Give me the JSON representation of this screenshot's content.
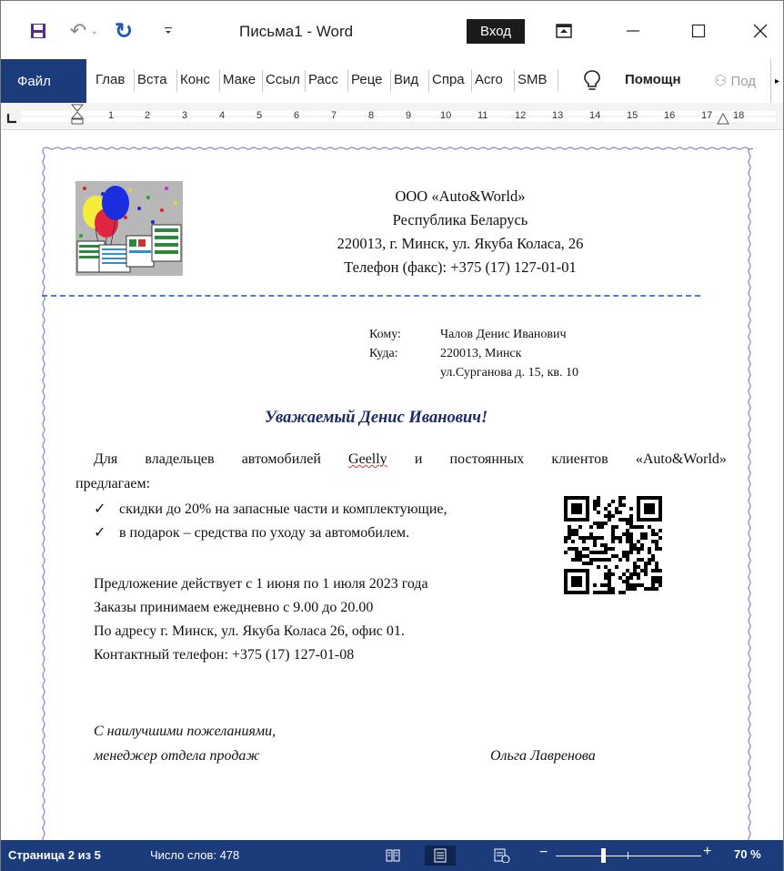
{
  "titlebar": {
    "doc_title": "Письма1  -  Word",
    "signin_label": "Вход"
  },
  "ribbon": {
    "file_tab": "Файл",
    "tabs": [
      "Глав",
      "Вста",
      "Конс",
      "Маке",
      "Ссыл",
      "Расс",
      "Реце",
      "Вид",
      "Спра",
      "Acro",
      "SMB"
    ],
    "help_label": "Помощн",
    "share_label": "Под"
  },
  "ruler": {
    "numbers": [
      "1",
      "2",
      "3",
      "4",
      "5",
      "6",
      "7",
      "8",
      "9",
      "10",
      "11",
      "12",
      "13",
      "14",
      "15",
      "16",
      "17",
      "18"
    ]
  },
  "letter": {
    "company_lines": [
      "ООО «Auto&World»",
      "Республика Беларусь",
      "220013, г. Минск, ул. Якуба Коласа, 26",
      "Телефон (факс): +375 (17) 127-01-01"
    ],
    "to_label": "Кому:",
    "to_value": "Чалов Денис Иванович",
    "where_label": "Куда:",
    "where_line1": "220013, Минск",
    "where_line2": "ул.Сурганова д. 15, кв. 10",
    "greeting": "Уважаемый Денис Иванович!",
    "intro_part1": "Для владельцев автомобилей ",
    "intro_brand": "Geelly",
    "intro_part2": " и постоянных клиентов «Auto&World»",
    "intro_line2": "предлагаем:",
    "check_mark": "✓",
    "bullet1": "скидки до 20% на запасные части и комплектующие,",
    "bullet2": "в подарок – средства по уходу за автомобилем.",
    "info1": "Предложение действует с 1 июня по 1 июля 2023 года",
    "info2": "Заказы принимаем ежедневно с 9.00 до 20.00",
    "info3": "По адресу г. Минск, ул. Якуба Коласа 26, офис 01.",
    "info4": "Контактный телефон: +375 (17) 127-01-08",
    "closing1": "С наилучшими пожеланиями,",
    "closing2": "менеджер отдела продаж",
    "signer": "Ольга Лавренова"
  },
  "statusbar": {
    "page": "Страница 2 из 5",
    "words": "Число слов: 478",
    "zoom": "70 %",
    "zoom_level_percent": 70
  },
  "colors": {
    "accent": "#1b3b7a",
    "greeting": "#1a2a66",
    "divider": "#4a7fd4"
  }
}
